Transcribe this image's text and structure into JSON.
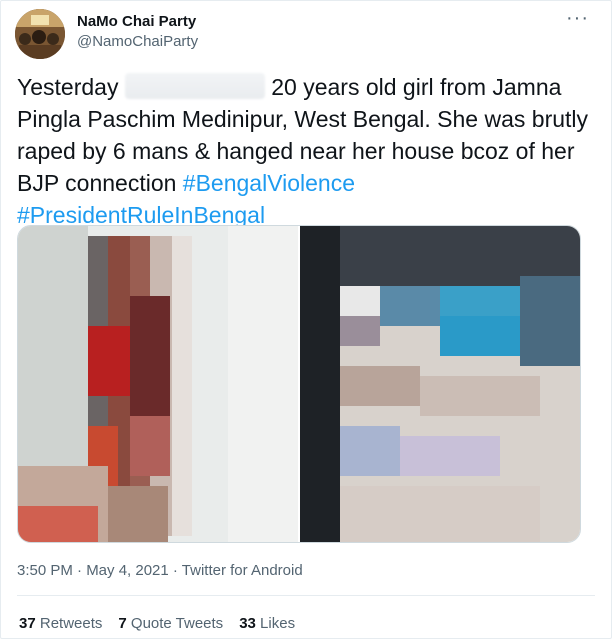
{
  "author": {
    "display_name": "NaMo Chai Party",
    "handle": "@NamoChaiParty"
  },
  "tweet": {
    "text_part1": "Yesterday",
    "text_part2": "20 years old girl from Jamna Pingla Paschim Medinipur, West Bengal. She was brutly raped by 6 mans & hanged near her house bcoz of her BJP connection",
    "hashtags": [
      "#BengalViolence",
      "#PresidentRuleInBengal"
    ]
  },
  "meta": {
    "timestamp": "3:50 PM · May 4, 2021 · Twitter for Android"
  },
  "stats": [
    {
      "count": "37",
      "label": "Retweets"
    },
    {
      "count": "7",
      "label": "Quote Tweets"
    },
    {
      "count": "33",
      "label": "Likes"
    }
  ],
  "colors": {
    "link": "#1d9bf0",
    "secondary_text": "#536471"
  },
  "icons": {
    "more": "more-options-icon"
  }
}
